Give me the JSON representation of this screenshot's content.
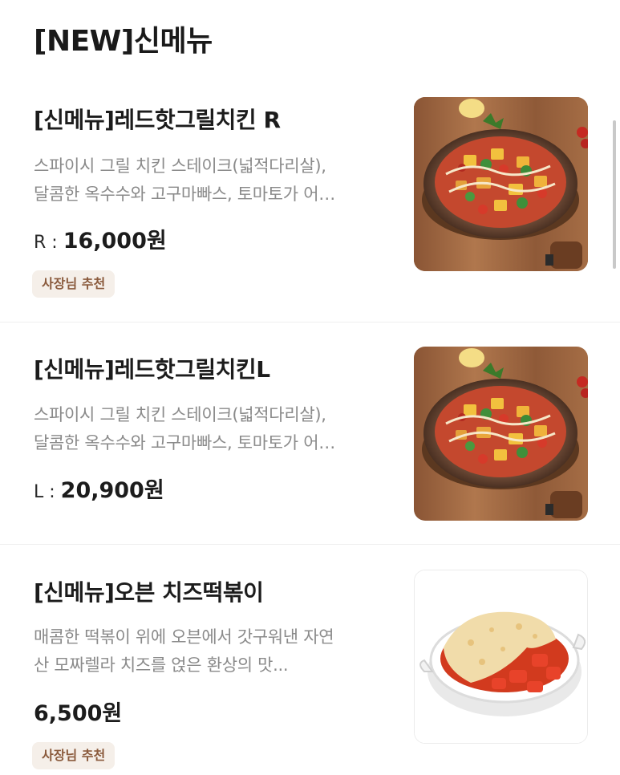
{
  "section": {
    "title": "[NEW]신메뉴"
  },
  "items": [
    {
      "name": "[신메뉴]레드핫그릴치킨 R",
      "desc_line1": "스파이시 그릴 치킨 스테이크(넓적다리살),",
      "desc_line2": "달콤한 옥수수와 고구마빠스, 토마토가 어…",
      "size_label": "R : ",
      "price": "16,000원",
      "badge": "사장님 추천"
    },
    {
      "name": "[신메뉴]레드핫그릴치킨L",
      "desc_line1": "스파이시 그릴 치킨 스테이크(넓적다리살),",
      "desc_line2": "달콤한 옥수수와 고구마빠스, 토마토가 어…",
      "size_label": "L : ",
      "price": "20,900원"
    },
    {
      "name": "[신메뉴]오븐 치즈떡볶이",
      "desc_line1": "매콤한 떡볶이 위에 오븐에서 갓구워낸 자연",
      "desc_line2": "산 모짜렐라 치즈를 얹은 환상의 맛...",
      "price": "6,500원",
      "badge": "사장님 추천"
    }
  ],
  "icons": {
    "item1_image": "pizza-image",
    "item2_image": "pizza-image",
    "item3_image": "cheese-tteokbokki-image"
  }
}
